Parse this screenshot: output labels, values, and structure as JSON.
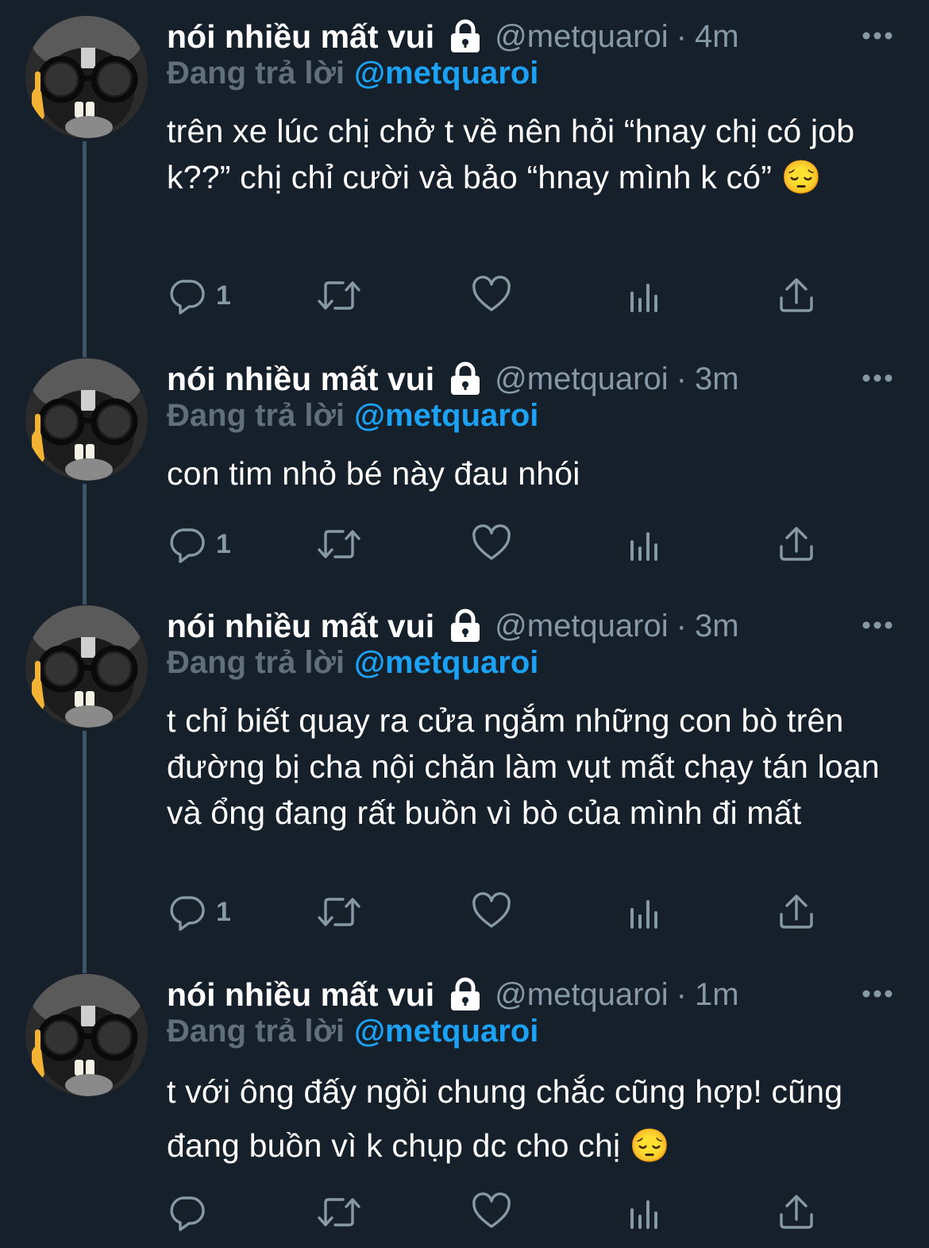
{
  "colors": {
    "background": "#15202b",
    "secondary_text": "#8899a6",
    "link": "#1da1f2",
    "thread_line": "#3d5466"
  },
  "tweets": [
    {
      "name": "nói nhiều mất vui",
      "handle": "@metquaroi",
      "separator": "·",
      "time": "4m",
      "replying_label": "Đang trả lời",
      "replying_to": "@metquaroi",
      "text": "trên xe lúc chị chở t về nên hỏi “hnay chị có job k??” chị chỉ cười và bảo “hnay mình k có” 😔",
      "reply_count": "1"
    },
    {
      "name": "nói nhiều mất vui",
      "handle": "@metquaroi",
      "separator": "·",
      "time": "3m",
      "replying_label": "Đang trả lời",
      "replying_to": "@metquaroi",
      "text": "con tim nhỏ bé này đau nhói",
      "reply_count": "1"
    },
    {
      "name": "nói nhiều mất vui",
      "handle": "@metquaroi",
      "separator": "·",
      "time": "3m",
      "replying_label": "Đang trả lời",
      "replying_to": "@metquaroi",
      "text": "t chỉ biết quay ra cửa ngắm những con bò trên đường bị cha nội chăn làm vụt mất chạy tán loạn và ổng đang rất buồn vì bò của mình đi mất",
      "reply_count": "1"
    },
    {
      "name": "nói nhiều mất vui",
      "handle": "@metquaroi",
      "separator": "·",
      "time": "1m",
      "replying_label": "Đang trả lời",
      "replying_to": "@metquaroi",
      "text": "t với ông đấy ngồi chung chắc cũng hợp! cũng đang buồn vì k chụp dc cho chị 😔",
      "reply_count": ""
    }
  ]
}
